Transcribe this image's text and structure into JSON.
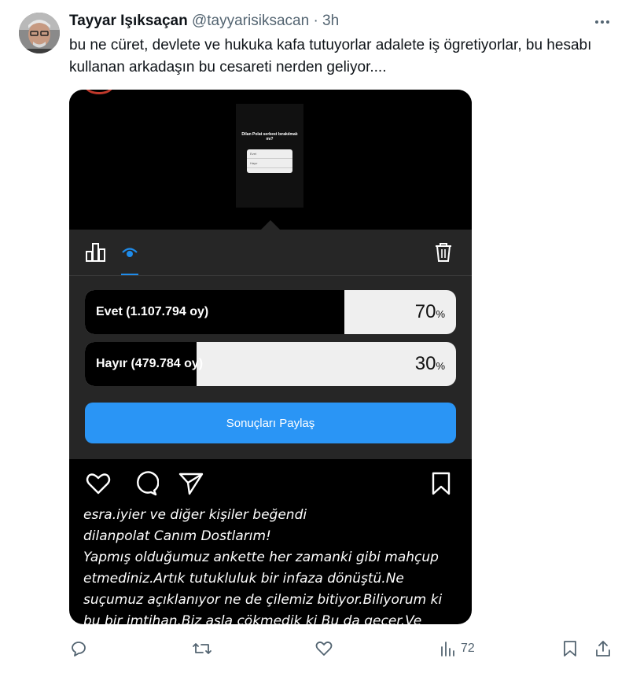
{
  "tweet": {
    "display_name": "Tayyar Işıksaçan",
    "handle": "@tayyarisiksacan",
    "separator": "·",
    "time": "3h",
    "text": "bu ne cüret, devlete ve hukuka kafa tutuyorlar adalete iş ögretiyorlar, bu hesabı kullanan arkadaşın bu cesareti nerden geliyor...."
  },
  "media": {
    "story_thumbnail": {
      "question": "Dilan Polat serbest bırakılmalı mı?",
      "options": [
        "Evet",
        "Hayır"
      ]
    },
    "poll": {
      "options": [
        {
          "label": "Evet (1.107.794 oy)",
          "percent_value": "70",
          "percent_sign": "%",
          "fraction": 0.7
        },
        {
          "label": "Hayır (479.784 oy)",
          "percent_value": "30",
          "percent_sign": "%",
          "fraction": 0.3
        }
      ],
      "share_label": "Sonuçları Paylaş"
    },
    "caption_lines": [
      "esra.iyier ve diğer kişiler beğendi",
      "dilanpolat Canım Dostlarım!",
      "Yapmış olduğumuz ankette her zamanki gibi mahçup",
      "etmediniz.Artık tutukluluk bir infaza dönüştü.Ne",
      "suçumuz açıklanıyor ne de çilemiz bitiyor.Biliyorum ki",
      "bu bir imtihan.Biz asla çökmedik ki Bu da geçer.Ve"
    ]
  },
  "actions": {
    "reply_count": "",
    "retweet_count": "",
    "like_count": "",
    "views_count": "72"
  },
  "colors": {
    "accent": "#2a95f5",
    "text_secondary": "#536471"
  }
}
